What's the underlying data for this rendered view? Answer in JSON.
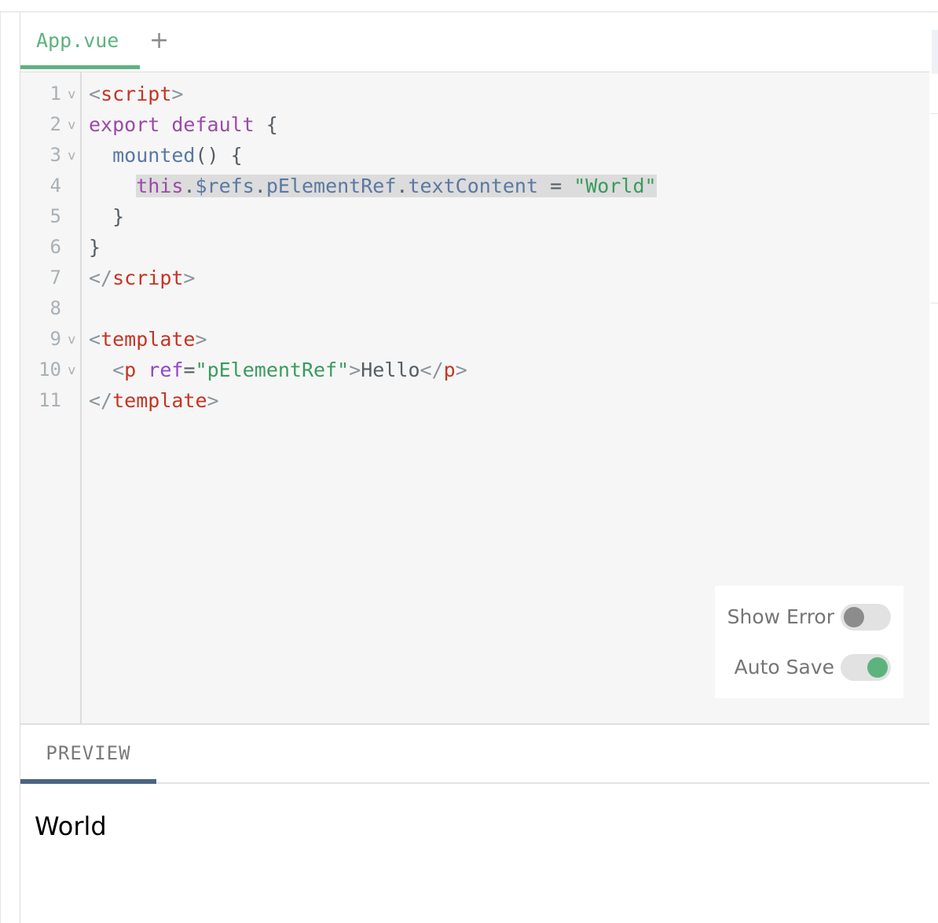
{
  "tabs": {
    "file_tab": "App.vue",
    "add_icon": "+"
  },
  "editor": {
    "line_numbers": [
      "1",
      "2",
      "3",
      "4",
      "5",
      "6",
      "7",
      "8",
      "9",
      "10",
      "11"
    ],
    "fold_marker": "v",
    "folded_lines": [
      1,
      2,
      3,
      9,
      10
    ],
    "highlighted_line": 4,
    "lines": [
      [
        {
          "t": "<",
          "c": "bracket"
        },
        {
          "t": "script",
          "c": "tag"
        },
        {
          "t": ">",
          "c": "bracket"
        }
      ],
      [
        {
          "t": "export default",
          "c": "kw"
        },
        {
          "t": " {",
          "c": "punct"
        }
      ],
      [
        {
          "t": "  ",
          "c": "punct"
        },
        {
          "t": "mounted",
          "c": "fn"
        },
        {
          "t": "() {",
          "c": "punct"
        }
      ],
      [
        {
          "t": "    ",
          "c": "punct"
        },
        {
          "t": "this",
          "c": "kw",
          "hl": true
        },
        {
          "t": ".",
          "c": "punct",
          "hl": true
        },
        {
          "t": "$refs",
          "c": "fn",
          "hl": true
        },
        {
          "t": ".",
          "c": "punct",
          "hl": true
        },
        {
          "t": "pElementRef",
          "c": "fn",
          "hl": true
        },
        {
          "t": ".",
          "c": "punct",
          "hl": true
        },
        {
          "t": "textContent",
          "c": "fn",
          "hl": true
        },
        {
          "t": " = ",
          "c": "punct",
          "hl": true
        },
        {
          "t": "\"World\"",
          "c": "str",
          "hl": true
        }
      ],
      [
        {
          "t": "  }",
          "c": "punct"
        }
      ],
      [
        {
          "t": "}",
          "c": "punct"
        }
      ],
      [
        {
          "t": "</",
          "c": "bracket"
        },
        {
          "t": "script",
          "c": "tag"
        },
        {
          "t": ">",
          "c": "bracket"
        }
      ],
      [],
      [
        {
          "t": "<",
          "c": "bracket"
        },
        {
          "t": "template",
          "c": "tag"
        },
        {
          "t": ">",
          "c": "bracket"
        }
      ],
      [
        {
          "t": "  ",
          "c": "punct"
        },
        {
          "t": "<",
          "c": "bracket"
        },
        {
          "t": "p",
          "c": "tag"
        },
        {
          "t": " ",
          "c": "punct"
        },
        {
          "t": "ref",
          "c": "attr"
        },
        {
          "t": "=",
          "c": "punct"
        },
        {
          "t": "\"pElementRef\"",
          "c": "str"
        },
        {
          "t": ">",
          "c": "bracket"
        },
        {
          "t": "Hello",
          "c": "punct"
        },
        {
          "t": "</",
          "c": "bracket"
        },
        {
          "t": "p",
          "c": "tag"
        },
        {
          "t": ">",
          "c": "bracket"
        }
      ],
      [
        {
          "t": "</",
          "c": "bracket"
        },
        {
          "t": "template",
          "c": "tag"
        },
        {
          "t": ">",
          "c": "bracket"
        }
      ]
    ]
  },
  "settings": {
    "show_error": {
      "label": "Show Error",
      "enabled": false
    },
    "auto_save": {
      "label": "Auto Save",
      "enabled": true
    }
  },
  "preview": {
    "tab_label": "PREVIEW",
    "output_text": "World"
  },
  "colors": {
    "accent_green": "#5cb37e",
    "preview_underline": "#4b6485",
    "tag_red": "#c33524",
    "keyword_purple": "#9b4aa8",
    "function_blue": "#5a78a3",
    "string_green": "#3a9b5e"
  }
}
